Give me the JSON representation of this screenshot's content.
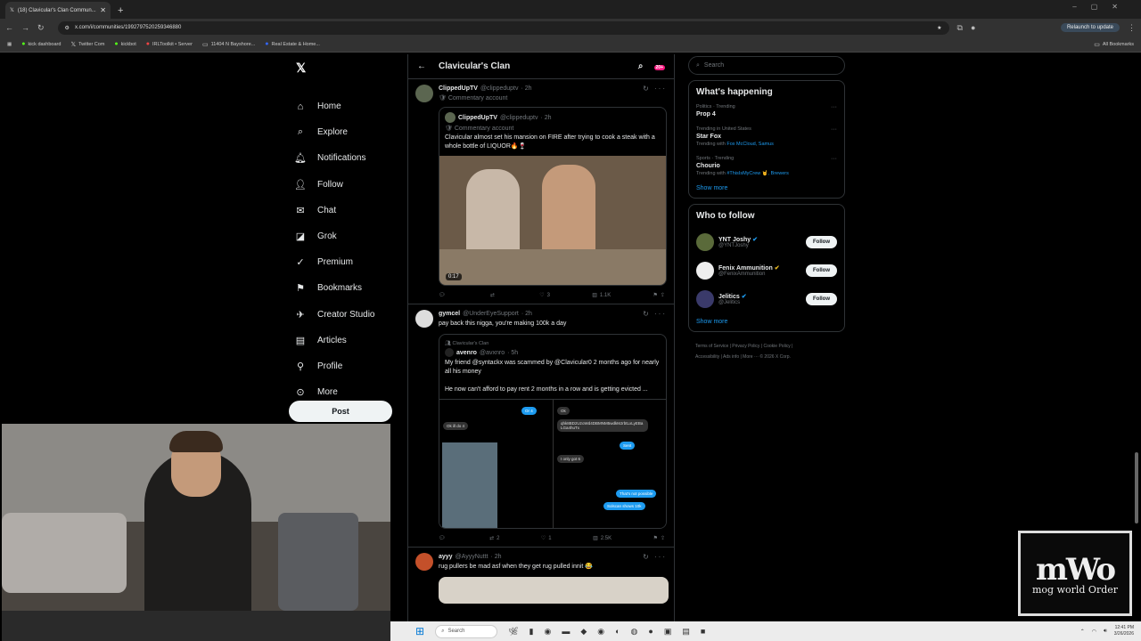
{
  "browser": {
    "tab_title": "(18) Clavicular's Clan Commun...",
    "url": "x.com/i/communities/1992797520259346880",
    "relaunch": "Relaunch to update",
    "bookmarks": [
      "kick dashboard",
      "Twitter Com",
      "kickbot",
      "IRLToolkit • Server",
      "11404 N Bayshore...",
      "Real Estate & Home..."
    ],
    "all_bookmarks": "All Bookmarks"
  },
  "nav": {
    "items": [
      "Home",
      "Explore",
      "Notifications",
      "Follow",
      "Chat",
      "Grok",
      "Premium",
      "Bookmarks",
      "Creator Studio",
      "Articles",
      "Profile",
      "More"
    ],
    "post": "Post"
  },
  "feed": {
    "title": "Clavicular's Clan",
    "badge": "20+",
    "tweets": [
      {
        "name": "ClippedUpTV",
        "handle": "@clippeduptv",
        "time": "· 2h",
        "sub": "Commentary account",
        "quote_name": "ClippedUpTV",
        "quote_handle": "@clippeduptv",
        "quote_time": "· 2h",
        "quote_sub": "Commentary account",
        "quote_text": "Clavicular almost set his mansion on FIRE after trying to cook a steak with a whole bottle of LIQUOR🔥🍷",
        "duration": "0:17",
        "stats": {
          "reply": "",
          "retweet": "",
          "like": "3",
          "views": "1.1K"
        }
      },
      {
        "name": "gymcel",
        "handle": "@UnderEyeSupport",
        "time": "· 2h",
        "text": "pay back this nigga, you're making 100k a day",
        "quote_community": "Clavicular's Clan",
        "quote_name": "avenro",
        "quote_handle": "@avxnro",
        "quote_time": "· 5h",
        "quote_text1": "My friend @syntackx was scammed by @Clavicular0 2 months ago for nearly all his money",
        "quote_text2": "He now can't afford to pay rent 2 months in a row and is getting evicted ...",
        "chat": {
          "b1": "Or 4",
          "b2": "Ok",
          "b3": "Ok ill do 4",
          "b4": "qhk8BD2UzoWd4DBMNM5wdkMJrbtLxLyEBaLGa4huTx",
          "b5": "Sent",
          "b6": "I only got 6",
          "b7": "That's not possible",
          "b8": "Solscan shows 10k"
        },
        "stats": {
          "reply": "",
          "retweet": "2",
          "like": "1",
          "views": "2.5K"
        }
      },
      {
        "name": "ayyy",
        "handle": "@AyyyNuttt",
        "time": "· 2h",
        "text": "rug pullers be mad asf when they get rug pulled innit 😂"
      }
    ]
  },
  "right": {
    "search_placeholder": "Search",
    "happening_title": "What's happening",
    "trends": [
      {
        "meta": "Politics · Trending",
        "name": "Prop 4",
        "with": "",
        "with_links": ""
      },
      {
        "meta": "Trending in United States",
        "name": "Star Fox",
        "with": "Trending with",
        "with_links": "Fox McCloud, Samus"
      },
      {
        "meta": "Sports · Trending",
        "name": "Chourio",
        "with": "Trending with",
        "with_links": "#ThisIsMyCrew 🤘, Brewers"
      }
    ],
    "show_more": "Show more",
    "follow_title": "Who to follow",
    "follows": [
      {
        "name": "YNT Joshy",
        "handle": "@YNTJoshy"
      },
      {
        "name": "Fenix Ammunition",
        "handle": "@FenixAmmunition"
      },
      {
        "name": "Jelitics",
        "handle": "@Jelitics"
      }
    ],
    "follow_btn": "Follow",
    "show_more2": "Show more",
    "footer1": "Terms of Service  |  Privacy Policy  |  Cookie Policy  |",
    "footer2": "Accessibility  |  Ads info  |  More ···  © 2026 X Corp."
  },
  "overlay": {
    "big": "mWo",
    "small": "mog world Order"
  },
  "taskbar": {
    "search": "Search",
    "time": "12:41 PM",
    "date": "3/26/2026"
  }
}
